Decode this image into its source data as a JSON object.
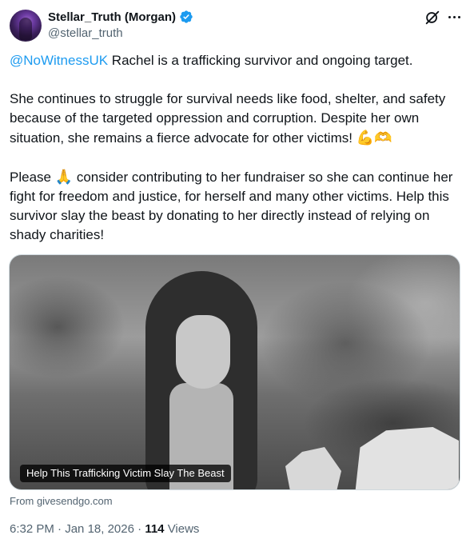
{
  "author": {
    "display_name": "Stellar_Truth (Morgan)",
    "handle": "@stellar_truth",
    "verified": true
  },
  "tweet": {
    "mention": "@NoWitnessUK",
    "para1_rest": " Rachel is a trafficking survivor and ongoing target.",
    "para2": "She continues to struggle for survival needs like food, shelter, and safety because of the targeted oppression and corruption. Despite her own situation, she remains a fierce advocate for other victims! ",
    "para2_emoji": "💪🫶",
    "para3_start": "Please ",
    "para3_emoji": "🙏",
    "para3_rest": " consider contributing to her fundraiser so she can continue her fight for freedom and justice, for herself and many other victims. Help this survivor slay the beast by donating to her directly instead of relying on shady charities!"
  },
  "card": {
    "caption": "Help This Trafficking Victim Slay The Beast",
    "source": "From givesendgo.com"
  },
  "meta": {
    "time": "6:32 PM",
    "date": "Jan 18, 2026",
    "views_count": "114",
    "views_label": "Views",
    "separator": "·"
  },
  "icons": {
    "verified": "verified-badge-icon",
    "grok": "grok-icon",
    "more": "more-options-icon"
  },
  "colors": {
    "link": "#1d9bf0",
    "verified": "#1d9bf0",
    "secondary_text": "#536471",
    "primary_text": "#0f1419"
  }
}
